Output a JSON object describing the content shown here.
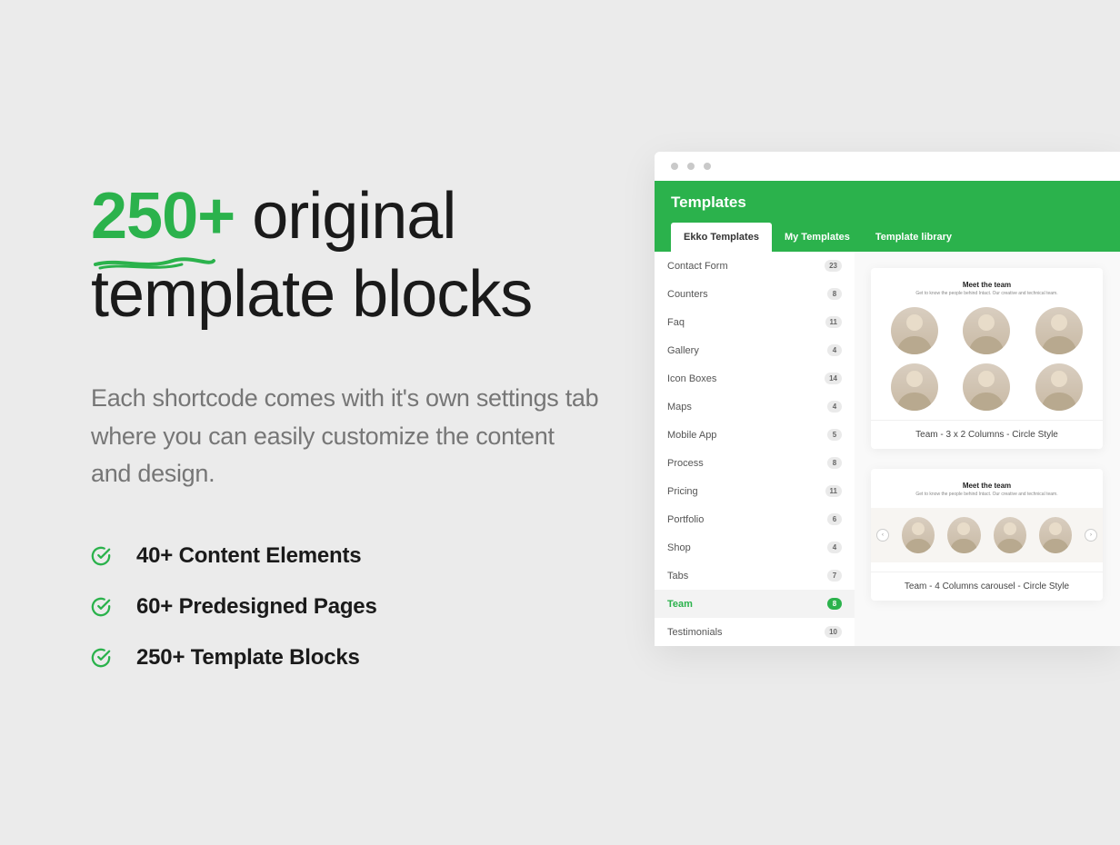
{
  "heading": {
    "accent": "250+",
    "rest": " original template blocks"
  },
  "subtext": "Each shortcode comes with it's own settings tab where you can easily customize the content and design.",
  "features": [
    "40+ Content Elements",
    "60+ Predesigned Pages",
    "250+ Template Blocks"
  ],
  "browser": {
    "title": "Templates",
    "tabs": [
      "Ekko Templates",
      "My Templates",
      "Template library"
    ],
    "activeTab": 0,
    "sidebar": [
      {
        "label": "Contact Form",
        "count": "23"
      },
      {
        "label": "Counters",
        "count": "8"
      },
      {
        "label": "Faq",
        "count": "11"
      },
      {
        "label": "Gallery",
        "count": "4"
      },
      {
        "label": "Icon Boxes",
        "count": "14"
      },
      {
        "label": "Maps",
        "count": "4"
      },
      {
        "label": "Mobile App",
        "count": "5"
      },
      {
        "label": "Process",
        "count": "8"
      },
      {
        "label": "Pricing",
        "count": "11"
      },
      {
        "label": "Portfolio",
        "count": "6"
      },
      {
        "label": "Shop",
        "count": "4"
      },
      {
        "label": "Tabs",
        "count": "7"
      },
      {
        "label": "Team",
        "count": "8",
        "active": true
      },
      {
        "label": "Testimonials",
        "count": "10"
      }
    ],
    "previews": [
      {
        "heading": "Meet the team",
        "sub": "Get to know the people behind Intact. Our creative and technical team.",
        "caption": "Team - 3 x 2 Columns - Circle Style"
      },
      {
        "heading": "Meet the team",
        "sub": "Get to know the people behind Intact. Our creative and technical team.",
        "caption": "Team - 4 Columns carousel - Circle Style"
      }
    ]
  },
  "colors": {
    "accent": "#2bb24c"
  }
}
